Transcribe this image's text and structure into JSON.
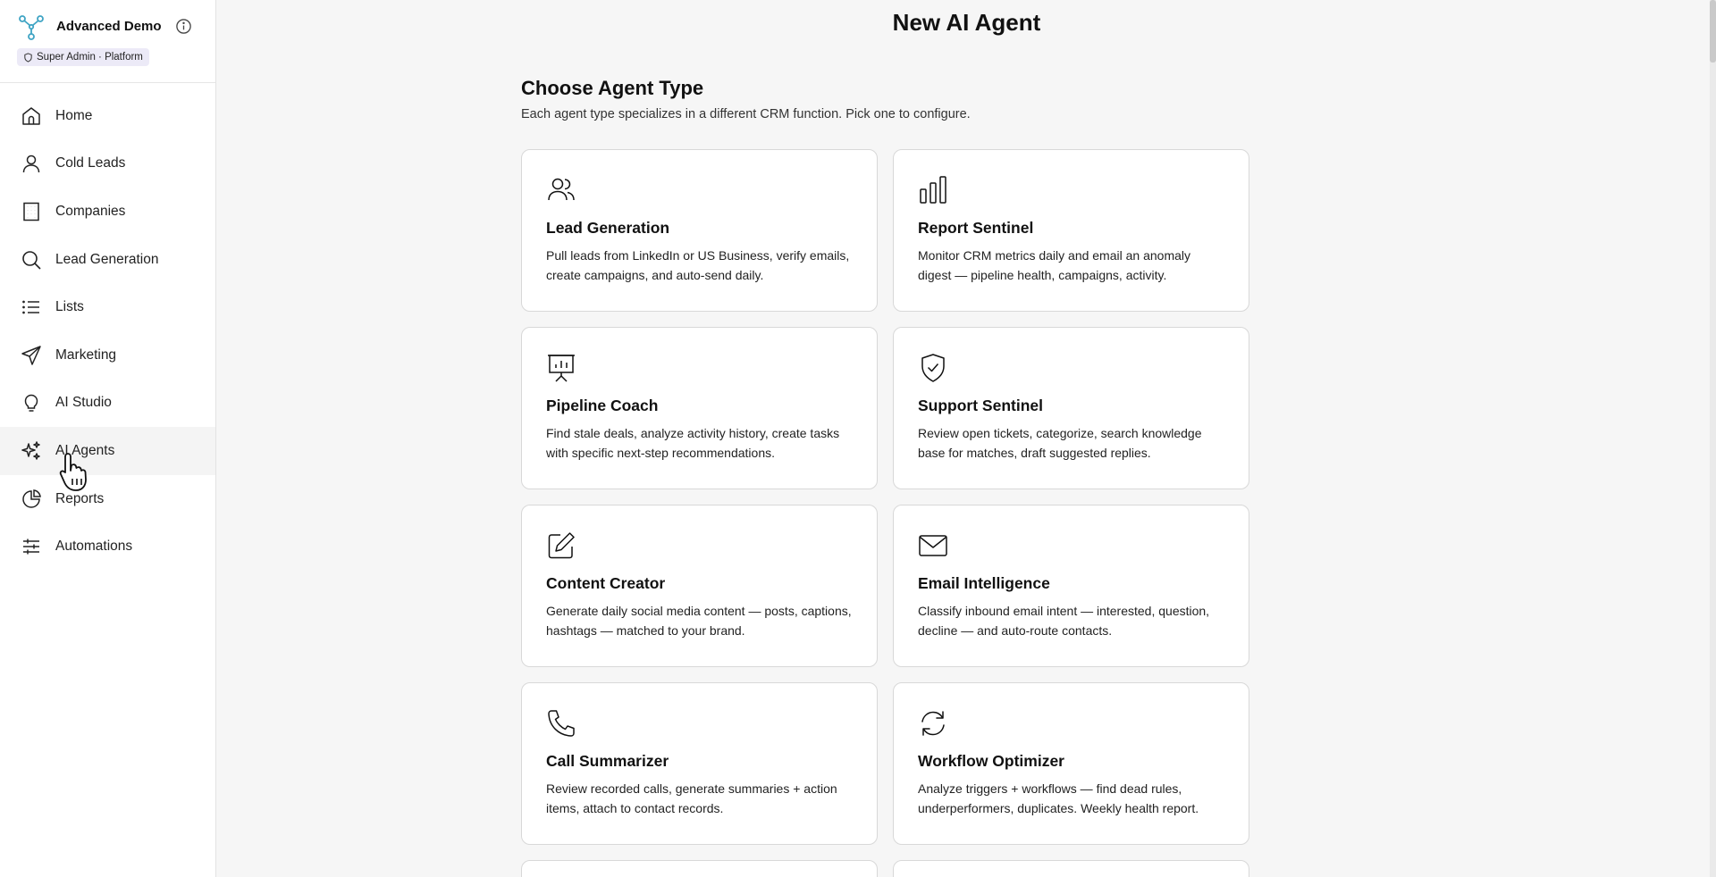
{
  "brand": {
    "name": "Advanced Demo",
    "role": "Super Admin · Platform",
    "logo_icon": "network-icon",
    "accent": "#3fa4c4"
  },
  "nav": {
    "items": [
      {
        "label": "Home",
        "icon": "home-icon"
      },
      {
        "label": "Cold Leads",
        "icon": "user-icon"
      },
      {
        "label": "Companies",
        "icon": "building-icon"
      },
      {
        "label": "Lead Generation",
        "icon": "search-icon"
      },
      {
        "label": "Lists",
        "icon": "list-icon"
      },
      {
        "label": "Marketing",
        "icon": "send-icon"
      },
      {
        "label": "AI Studio",
        "icon": "lightbulb-icon"
      },
      {
        "label": "AI Agents",
        "icon": "sparkles-icon",
        "active": true
      },
      {
        "label": "Reports",
        "icon": "pie-chart-icon"
      },
      {
        "label": "Automations",
        "icon": "sliders-icon"
      }
    ]
  },
  "page": {
    "title": "New AI Agent",
    "section_title": "Choose Agent Type",
    "section_subtitle": "Each agent type specializes in a different CRM function. Pick one to configure."
  },
  "agents": [
    {
      "title": "Lead Generation",
      "desc": "Pull leads from LinkedIn or US Business, verify emails, create campaigns, and auto-send daily.",
      "icon": "users-icon"
    },
    {
      "title": "Report Sentinel",
      "desc": "Monitor CRM metrics daily and email an anomaly digest — pipeline health, campaigns, activity.",
      "icon": "bar-chart-icon"
    },
    {
      "title": "Pipeline Coach",
      "desc": "Find stale deals, analyze activity history, create tasks with specific next-step recommendations.",
      "icon": "presentation-icon"
    },
    {
      "title": "Support Sentinel",
      "desc": "Review open tickets, categorize, search knowledge base for matches, draft suggested replies.",
      "icon": "shield-check-icon"
    },
    {
      "title": "Content Creator",
      "desc": "Generate daily social media content — posts, captions, hashtags — matched to your brand.",
      "icon": "pencil-square-icon"
    },
    {
      "title": "Email Intelligence",
      "desc": "Classify inbound email intent — interested, question, decline — and auto-route contacts.",
      "icon": "mail-icon"
    },
    {
      "title": "Call Summarizer",
      "desc": "Review recorded calls, generate summaries + action items, attach to contact records.",
      "icon": "phone-icon"
    },
    {
      "title": "Workflow Optimizer",
      "desc": "Analyze triggers + workflows — find dead rules, underperformers, duplicates. Weekly health report.",
      "icon": "refresh-icon"
    }
  ]
}
